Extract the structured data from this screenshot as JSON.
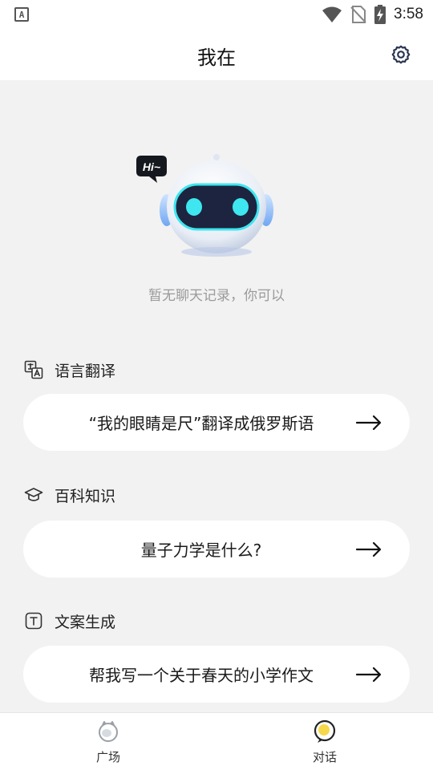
{
  "status_bar": {
    "left_icon": "A",
    "icons": [
      "wifi-icon",
      "no-sim-icon",
      "battery-charging-icon"
    ],
    "time": "3:58"
  },
  "header": {
    "title": "我在",
    "settings_icon": "gear-icon"
  },
  "empty_state": {
    "bubble_text": "Hi~",
    "message": "暂无聊天记录，你可以"
  },
  "sections": [
    {
      "icon": "translate-icon",
      "title": "语言翻译",
      "prompt": "“我的眼睛是尺”翻译成俄罗斯语"
    },
    {
      "icon": "graduation-cap-icon",
      "title": "百科知识",
      "prompt": "量子力学是什么?"
    },
    {
      "icon": "text-box-icon",
      "title": "文案生成",
      "prompt": "帮我写一个关于春天的小学作文"
    }
  ],
  "bottom_nav": {
    "items": [
      {
        "label": "广场",
        "icon": "plaza-icon",
        "active": false
      },
      {
        "label": "对话",
        "icon": "chat-icon",
        "active": true
      }
    ]
  },
  "colors": {
    "background": "#f2f2f2",
    "card": "#ffffff",
    "robot_eye": "#3ee6f0",
    "robot_face": "#1d2440",
    "accent_yellow": "#f5d94a",
    "muted_text": "#9a9a9a"
  }
}
